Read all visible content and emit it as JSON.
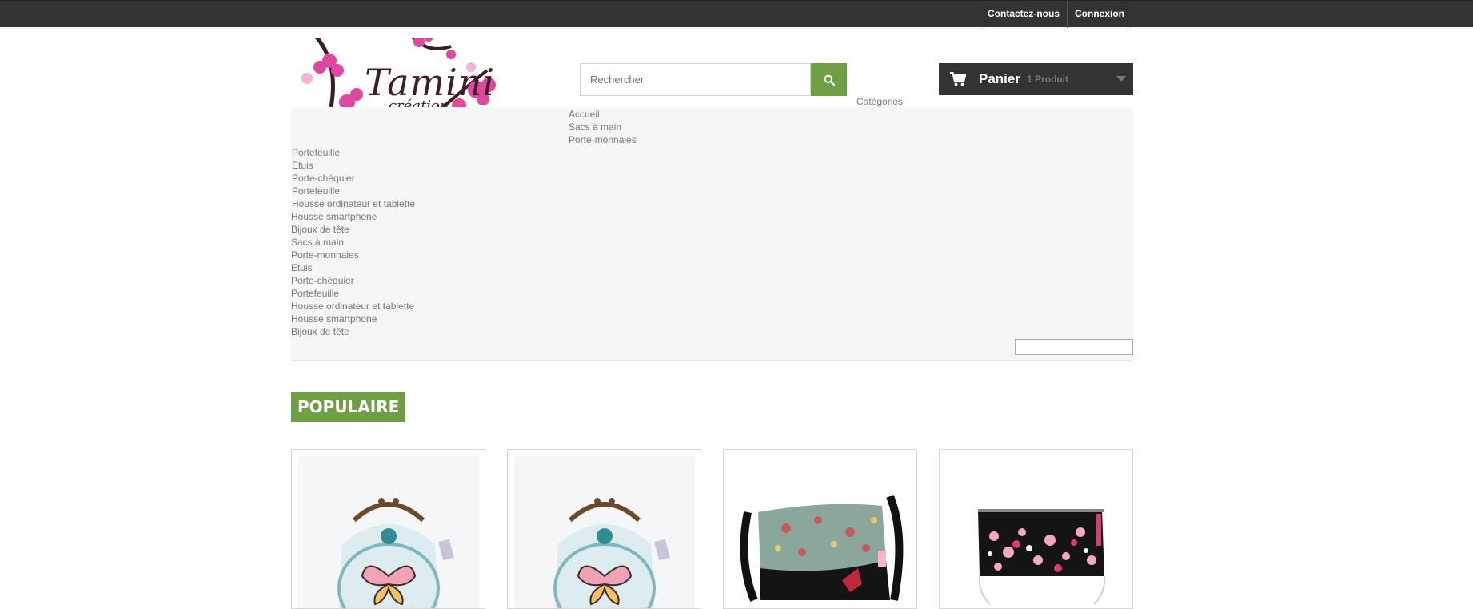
{
  "topbar": {
    "contact_label": "Contactez-nous",
    "login_label": "Connexion"
  },
  "logo": {
    "title": "Tamini",
    "subtitle": "création"
  },
  "search": {
    "placeholder": "Rechercher",
    "icon": "search-icon"
  },
  "cart": {
    "label": "Panier",
    "count": "1 Produit",
    "icon": "cart-icon"
  },
  "categories_label": "Catégories",
  "menu": {
    "top_items": [
      "Accueil",
      "Sacs à main",
      "Porte-monnaies"
    ],
    "items": [
      "Portefeuille",
      "Etuis",
      "Porte-chéquier",
      "Portefeuille",
      "Housse ordinateur et tablette",
      "Housse smartphone",
      "Bijoux de tête",
      "Sacs à main",
      "Porte-monnaies",
      "Etuis",
      "Porte-chéquier",
      "Portefeuille",
      "Housse ordinateur et tablette",
      "Housse smartphone",
      "Bijoux de tête"
    ]
  },
  "section": {
    "tab_label": "POPULAIRE"
  },
  "colors": {
    "accent": "#6f9e45",
    "dark": "#333333"
  }
}
